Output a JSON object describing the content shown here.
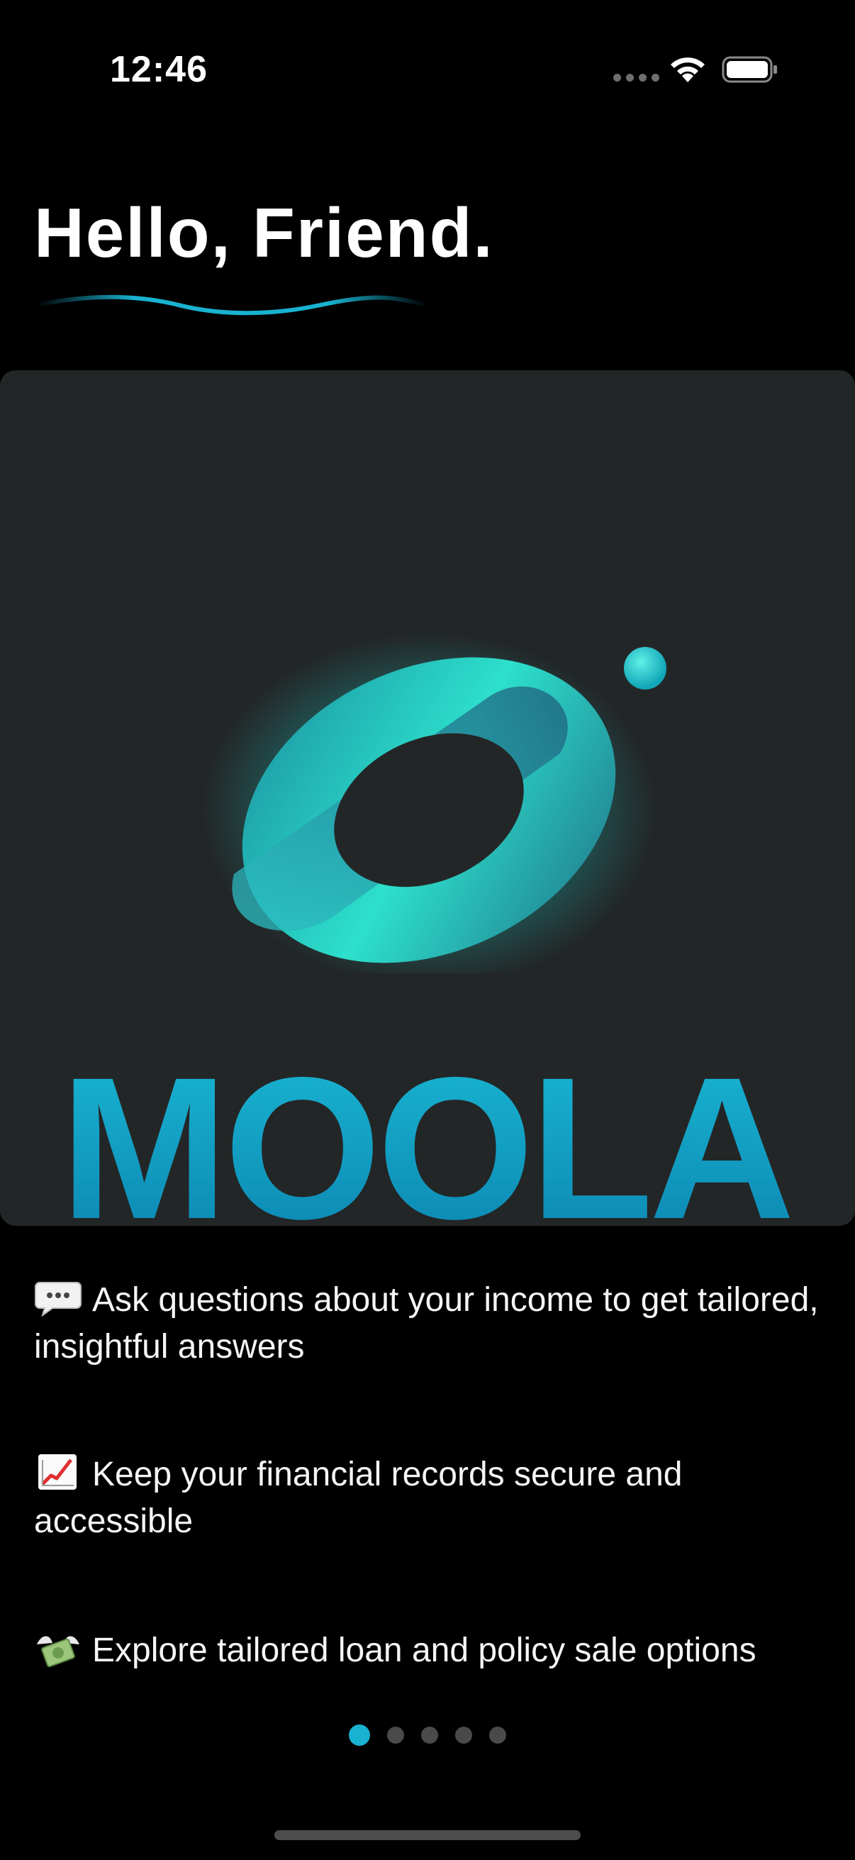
{
  "status_bar": {
    "time": "12:46",
    "icons": [
      "signal-dots-icon",
      "wifi-icon",
      "battery-icon"
    ]
  },
  "header": {
    "greeting": "Hello, Friend."
  },
  "hero": {
    "brand": "MOOLA",
    "logo": "moola-logo-icon"
  },
  "features": [
    {
      "icon": "speech-bubble-emoji",
      "text": "Ask questions about your income to get tailored, insightful answers"
    },
    {
      "icon": "chart-increasing-emoji",
      "text": "Keep your financial records secure and accessible"
    },
    {
      "icon": "money-with-wings-emoji",
      "text": "Explore tailored loan and policy sale options"
    }
  ],
  "pager": {
    "page_count": 5,
    "active_page": 1
  },
  "colors": {
    "accent": "#19B2D0",
    "background": "#000000",
    "card": "#232627",
    "inactive_dot": "#4A4A4A"
  }
}
